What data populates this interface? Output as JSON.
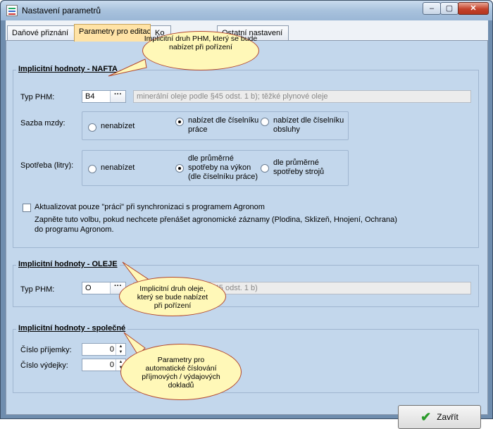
{
  "window": {
    "title": "Nastavení parametrů"
  },
  "tabs": [
    {
      "label": "Daňové přiznání"
    },
    {
      "label": "Parametry pro editaci"
    },
    {
      "label": "Ko"
    },
    {
      "label": "Ostatní nastavení"
    }
  ],
  "nafta": {
    "group_label": "Implicitní hodnoty - NAFTA",
    "typ_label": "Typ PHM:",
    "typ_value": "B4",
    "typ_desc": "minerální oleje podle §45 odst. 1 b); těžké plynové oleje",
    "sazba_label": "Sazba mzdy:",
    "sazba_options": [
      "nenabízet",
      "nabízet dle číselníku práce",
      "nabízet dle číselníku obsluhy"
    ],
    "sazba_selected": 1,
    "spotreba_label": "Spotřeba (litry):",
    "spotreba_options": [
      "nenabízet",
      "dle průměrné spotřeby na výkon (dle číselníku práce)",
      "dle průměrné spotřeby strojů"
    ],
    "spotreba_selected": 1,
    "checkbox_label": "Aktualizovat pouze \"práci\" při synchronizaci s programem Agronom",
    "checkbox_checked": false,
    "checkbox_help": "Zapněte tuto volbu, pokud nechcete přenášet agronomické záznamy (Plodina, Sklizeň, Hnojení, Ochrana) do programu Agronom."
  },
  "oleje": {
    "group_label": "Implicitní hodnoty - OLEJE",
    "typ_label": "Typ PHM:",
    "typ_value": "O",
    "typ_desc": "minerální oleje podle §45 odst. 1 b)"
  },
  "spolecne": {
    "group_label": "Implicitní hodnoty - společné",
    "prijemka_label": "Číslo příjemky:",
    "prijemka_value": "0",
    "vydejka_label": "Číslo výdejky:",
    "vydejka_value": "0"
  },
  "callouts": {
    "phm": "Implicitní druh PHM, který se bude nabízet při pořízení",
    "olej": "Implicitní druh oleje, který se bude nabízet při pořízení",
    "cislovani": "Parametry pro automatické číslování příjmových / výdajových dokladů"
  },
  "buttons": {
    "close_label": "Zavřít"
  }
}
